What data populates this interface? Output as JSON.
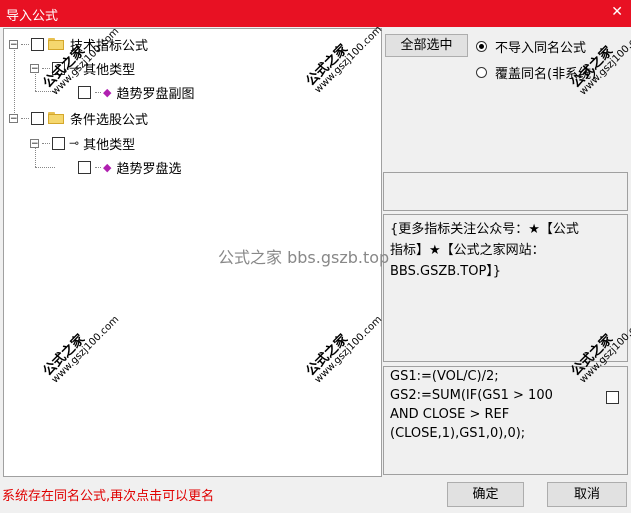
{
  "window": {
    "title": "导入公式",
    "close_glyph": "✕"
  },
  "tree": {
    "group1": {
      "label": "技术指标公式",
      "sub": "其他类型",
      "item": "趋势罗盘副图"
    },
    "group2": {
      "label": "条件选股公式",
      "sub": "其他类型",
      "item": "趋势罗盘选"
    }
  },
  "buttons": {
    "select_all": "全部选中",
    "ok": "确定",
    "cancel": "取消"
  },
  "radios": {
    "no_import": "不导入同名公式",
    "overwrite": "覆盖同名(非系统)"
  },
  "description": "{更多指标关注公众号：★【公式指标】★【公式之家网站：BBS.GSZB.TOP】}",
  "formula": "GS1:=(VOL/C)/2;\nGS2:=SUM(IF(GS1 > 100\nAND CLOSE > REF\n(CLOSE,1),GS1,0),0);",
  "status": "系统存在同名公式,再次点击可以更名",
  "watermark": {
    "big": "公式之家",
    "small": "www.gszj100.com",
    "center": "公式之家 bbs.gszb.top"
  },
  "icons": {
    "folder": "folder-icon",
    "key": "key-icon",
    "gem": "formula-gem-icon"
  }
}
